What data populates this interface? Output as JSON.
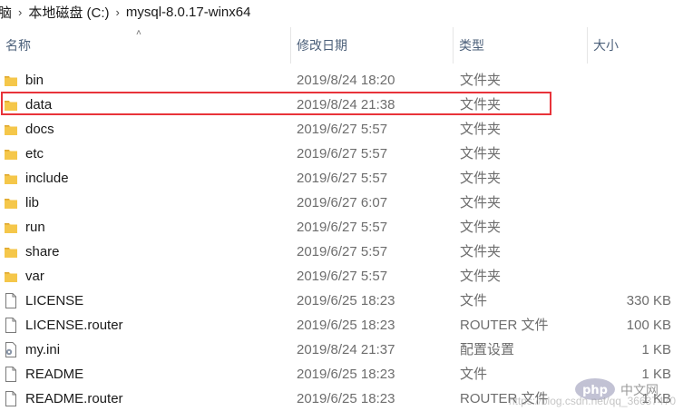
{
  "breadcrumb": {
    "partial_prev": "脑",
    "drive": "本地磁盘 (C:)",
    "folder": "mysql-8.0.17-winx64"
  },
  "columns": {
    "name": "名称",
    "date": "修改日期",
    "type": "类型",
    "size": "大小"
  },
  "files": [
    {
      "name": "bin",
      "date": "2019/8/24 18:20",
      "type": "文件夹",
      "size": "",
      "icon": "folder-icon"
    },
    {
      "name": "data",
      "date": "2019/8/24 21:38",
      "type": "文件夹",
      "size": "",
      "icon": "folder-icon"
    },
    {
      "name": "docs",
      "date": "2019/6/27 5:57",
      "type": "文件夹",
      "size": "",
      "icon": "folder-icon"
    },
    {
      "name": "etc",
      "date": "2019/6/27 5:57",
      "type": "文件夹",
      "size": "",
      "icon": "folder-icon"
    },
    {
      "name": "include",
      "date": "2019/6/27 5:57",
      "type": "文件夹",
      "size": "",
      "icon": "folder-icon"
    },
    {
      "name": "lib",
      "date": "2019/6/27 6:07",
      "type": "文件夹",
      "size": "",
      "icon": "folder-icon"
    },
    {
      "name": "run",
      "date": "2019/6/27 5:57",
      "type": "文件夹",
      "size": "",
      "icon": "folder-icon"
    },
    {
      "name": "share",
      "date": "2019/6/27 5:57",
      "type": "文件夹",
      "size": "",
      "icon": "folder-icon"
    },
    {
      "name": "var",
      "date": "2019/6/27 5:57",
      "type": "文件夹",
      "size": "",
      "icon": "folder-icon"
    },
    {
      "name": "LICENSE",
      "date": "2019/6/25 18:23",
      "type": "文件",
      "size": "330 KB",
      "icon": "file-icon"
    },
    {
      "name": "LICENSE.router",
      "date": "2019/6/25 18:23",
      "type": "ROUTER 文件",
      "size": "100 KB",
      "icon": "file-icon"
    },
    {
      "name": "my.ini",
      "date": "2019/8/24 21:37",
      "type": "配置设置",
      "size": "1 KB",
      "icon": "settings-file-icon"
    },
    {
      "name": "README",
      "date": "2019/6/25 18:23",
      "type": "文件",
      "size": "1 KB",
      "icon": "file-icon"
    },
    {
      "name": "README.router",
      "date": "2019/6/25 18:23",
      "type": "ROUTER 文件",
      "size": "1 KB",
      "icon": "file-icon"
    }
  ],
  "watermark": {
    "text": "https://blog.csdn.net/qq_36637470",
    "logo_text": "php 中文网"
  },
  "colors": {
    "folder": "#f5c64a",
    "highlight": "#e8333a",
    "header_text": "#4c607a",
    "secondary_text": "#6d6d6d"
  }
}
